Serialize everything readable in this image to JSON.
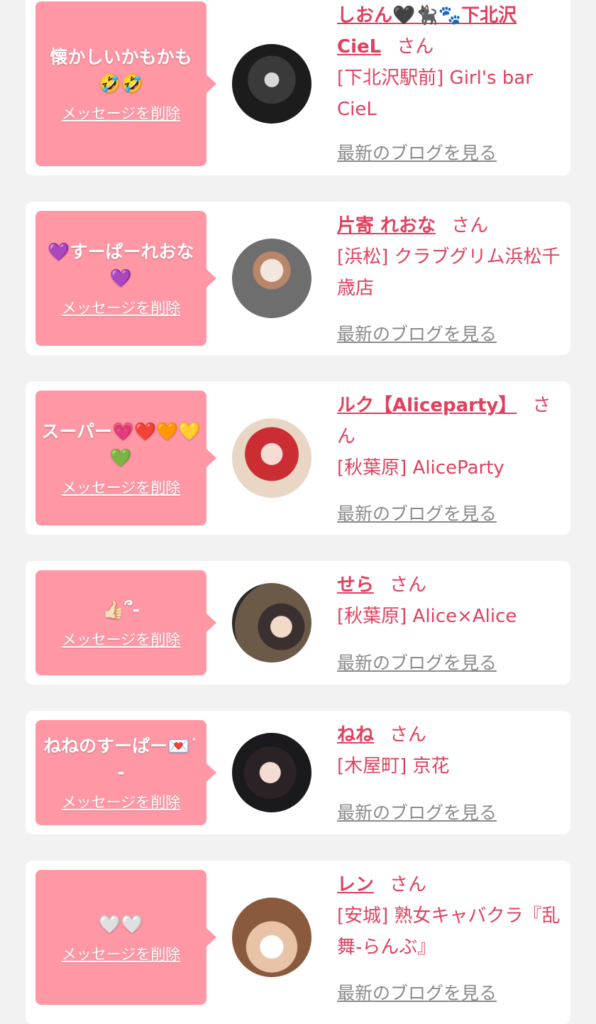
{
  "delete_label": "メッセージを削除",
  "blog_label": "最新のブログを見る",
  "suffix": "さん",
  "colors": {
    "bubble": "#ff97a5",
    "name": "#e0405e",
    "link_gray": "#8a8a8a"
  },
  "cards": [
    {
      "message": "懐かしいかもかも🤣🤣",
      "name": "しおん🖤🐈‍⬛🐾下北沢CieL",
      "shop": "[下北沢駅前] Girl's bar CieL"
    },
    {
      "message": "💜すーぱーれおな💜",
      "name": "片寄 れおな",
      "shop": "[浜松] クラブグリム浜松千歳店"
    },
    {
      "message": "スーパー💗❤️🧡💛💚",
      "name": "ルク【Aliceparty】",
      "shop": "[秋葉原] AliceParty"
    },
    {
      "message": "👍🏻՞-",
      "name": "せら",
      "shop": "[秋葉原] Alice×Alice"
    },
    {
      "message": "ねねのすーぱー💌˙-",
      "name": "ねね",
      "shop": "[木屋町] 京花"
    },
    {
      "message": "🤍🤍",
      "name": "レン",
      "shop": "[安城] 熟女キャバクラ『乱舞-らんぶ』"
    }
  ]
}
